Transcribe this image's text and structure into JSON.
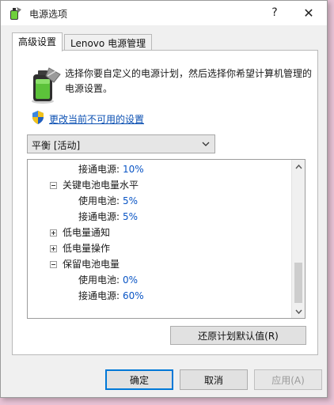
{
  "window": {
    "title": "电源选项",
    "help": "?",
    "close": "✕"
  },
  "tabs": [
    {
      "label": "高级设置",
      "active": true
    },
    {
      "label": "Lenovo 电源管理",
      "active": false
    }
  ],
  "description": "选择你要自定义的电源计划，然后选择你希望计算机管理的电源设置。",
  "change_link": "更改当前不可用的设置",
  "plan_select": {
    "value": "平衡 [活动]"
  },
  "tree": {
    "rows": [
      {
        "label": "接通电源:",
        "value": "10%"
      },
      {
        "label": "关键电池电量水平",
        "expander": "minus"
      },
      {
        "label": "使用电池:",
        "value": "5%"
      },
      {
        "label": "接通电源:",
        "value": "5%"
      },
      {
        "label": "低电量通知",
        "expander": "plus"
      },
      {
        "label": "低电量操作",
        "expander": "plus"
      },
      {
        "label": "保留电池电量",
        "expander": "minus"
      },
      {
        "label": "使用电池:",
        "value": "0%"
      },
      {
        "label": "接通电源:",
        "value": "60%"
      }
    ]
  },
  "restore_button": "还原计划默认值(R)",
  "buttons": {
    "ok": "确定",
    "cancel": "取消",
    "apply": "应用(A)"
  },
  "colors": {
    "link": "#0a4fb2",
    "value": "#0a55c5",
    "accent": "#0078d7"
  }
}
